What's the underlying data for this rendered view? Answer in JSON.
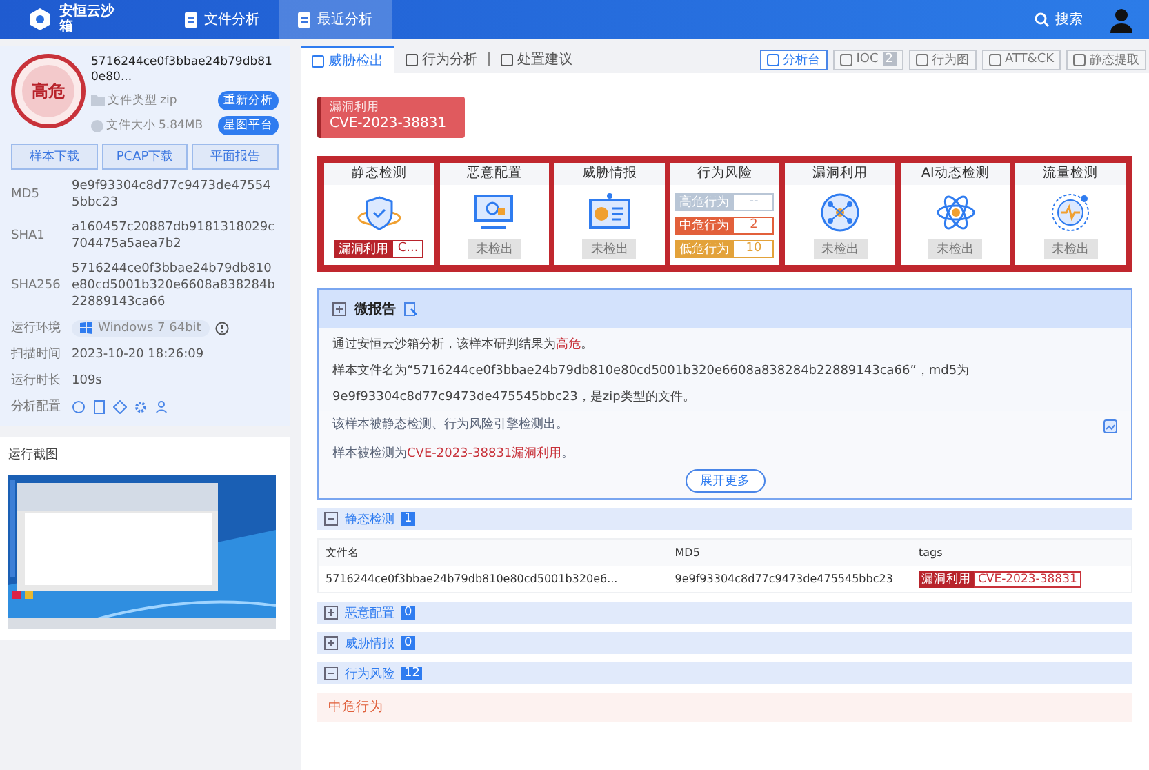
{
  "app": {
    "name": "安恒云沙箱"
  },
  "nav_tabs": [
    {
      "label": "文件分析",
      "selected": false
    },
    {
      "label": "最近分析",
      "selected": true
    }
  ],
  "search": {
    "label": "搜索"
  },
  "sample": {
    "verdict": "高危",
    "file_name": "5716244ce0f3bbae24b79db810e80...",
    "file_type_label": "文件类型",
    "file_type": "zip",
    "file_size_label": "文件大小",
    "file_size": "5.84MB",
    "actions": [
      "重新分析",
      "星图平台"
    ]
  },
  "downloads": [
    "样本下载",
    "PCAP下载",
    "平面报告"
  ],
  "details": [
    {
      "label": "MD5",
      "kind": "text",
      "value": "9e9f93304c8d77c9473de475545bbc23"
    },
    {
      "label": "SHA1",
      "kind": "text",
      "value": "a160457c20887db9181318029c704475a5aea7b2"
    },
    {
      "label": "SHA256",
      "kind": "text",
      "value": "5716244ce0f3bbae24b79db810e80cd5001b320e6608a838284b22889143ca66"
    },
    {
      "label": "运行环境",
      "kind": "env",
      "value": "Windows 7 64bit"
    },
    {
      "label": "扫描时间",
      "kind": "text",
      "value": "2023-10-20 18:26:09"
    },
    {
      "label": "运行时长",
      "kind": "text",
      "value": "109s"
    },
    {
      "label": "分析配置",
      "kind": "icons"
    }
  ],
  "screenshot": {
    "title": "运行截图"
  },
  "main_tabs": [
    {
      "label": "威胁检出",
      "selected": true
    },
    {
      "label": "行为分析",
      "selected": false
    },
    {
      "label": "处置建议",
      "selected": false
    }
  ],
  "toolbar": [
    {
      "label": "分析台",
      "selected": true
    },
    {
      "label": "IOC",
      "count": "2",
      "selected": false
    },
    {
      "label": "行为图",
      "selected": false
    },
    {
      "label": "ATT&CK",
      "selected": false
    },
    {
      "label": "静态提取",
      "selected": false
    }
  ],
  "threat_banner": {
    "category": "漏洞利用",
    "name": "CVE-2023-38831"
  },
  "engines": [
    {
      "name": "静态检测",
      "kind": "tag",
      "tag": "漏洞利用",
      "value": "C..."
    },
    {
      "name": "恶意配置",
      "kind": "status",
      "status": "未检出"
    },
    {
      "name": "威胁情报",
      "kind": "status",
      "status": "未检出"
    },
    {
      "name": "行为风险",
      "kind": "levels",
      "levels": [
        {
          "label": "高危行为",
          "value": "--",
          "color": "#b9c6d6"
        },
        {
          "label": "中危行为",
          "value": "2",
          "color": "#e2603b"
        },
        {
          "label": "低危行为",
          "value": "10",
          "color": "#e3a23a"
        }
      ]
    },
    {
      "name": "漏洞利用",
      "kind": "status",
      "status": "未检出"
    },
    {
      "name": "AI动态检测",
      "kind": "status",
      "status": "未检出"
    },
    {
      "name": "流量检测",
      "kind": "status",
      "status": "未检出"
    }
  ],
  "report": {
    "title": "微报告",
    "paragraphs": [
      "通过安恒云沙箱分析，该样本研判结果为**高危**。",
      "样本文件名为“5716244ce0f3bbae24b79db810e80cd5001b320e6608a838284b22889143ca66”，md5为9e9f93304c8d77c9473de475545bbc23，是zip类型的文件。"
    ],
    "findings": [
      "该样本被静态检测、行为风险引擎检测出。",
      "样本被检测为**CVE-2023-38831漏洞利用**。"
    ],
    "more": "展开更多"
  },
  "sections": [
    {
      "title": "静态检测",
      "count": "1",
      "expanded": true,
      "table": {
        "columns": [
          "文件名",
          "MD5",
          "tags"
        ],
        "rows": [
          {
            "file": "5716244ce0f3bbae24b79db810e80cd5001b320e6...",
            "md5": "9e9f93304c8d77c9473de475545bbc23",
            "tags": [
              "漏洞利用",
              "CVE-2023-38831"
            ]
          }
        ]
      }
    },
    {
      "title": "恶意配置",
      "count": "0",
      "expanded": false
    },
    {
      "title": "威胁情报",
      "count": "0",
      "expanded": false
    },
    {
      "title": "行为风险",
      "count": "12",
      "expanded": true,
      "subheading": "中危行为"
    }
  ]
}
